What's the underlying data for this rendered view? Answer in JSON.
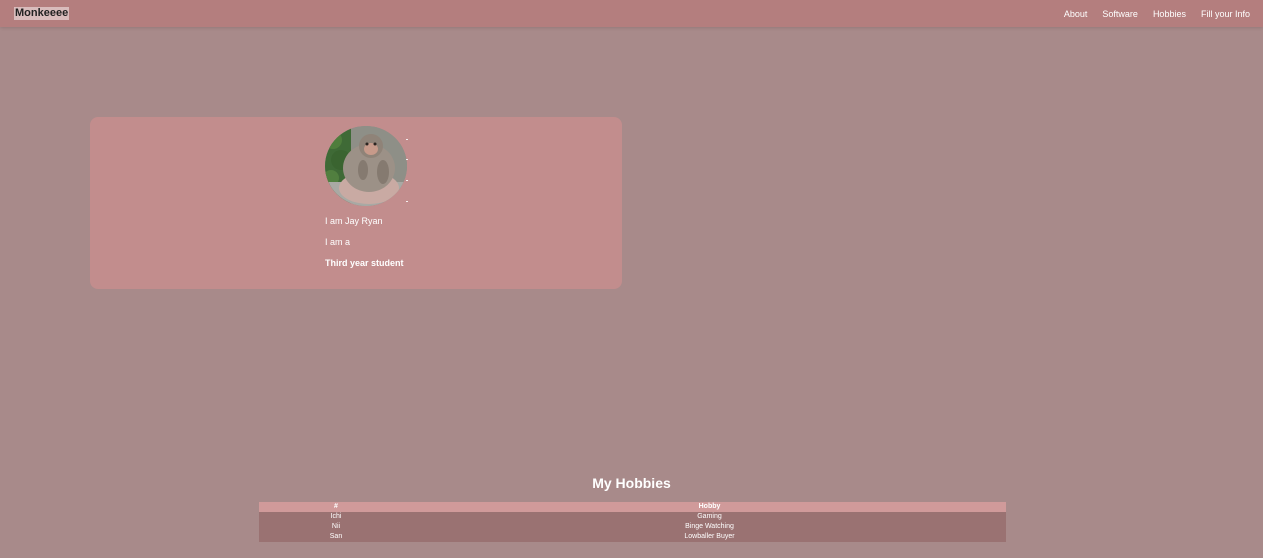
{
  "navbar": {
    "brand": "Monkeeee",
    "links": [
      {
        "label": "About"
      },
      {
        "label": "Software"
      },
      {
        "label": "Hobbies"
      },
      {
        "label": "Fill your Info"
      }
    ]
  },
  "profile": {
    "avatar_icon": "monkey-photo",
    "name_line": "I am Jay Ryan",
    "role_line": "I am a",
    "year_line": "Third year student"
  },
  "hobbies": {
    "title": "My Hobbies",
    "columns": [
      "#",
      "Hobby"
    ],
    "rows": [
      [
        "Ichi",
        "Gaming"
      ],
      [
        "Nii",
        "Binge Watching"
      ],
      [
        "San",
        "Lowballer Buyer"
      ]
    ]
  },
  "colors": {
    "page_background": "#a88a8a",
    "navbar": "#b47e7e",
    "card": "#c28d8d",
    "table_header": "#d09a9a",
    "table_body": "#9a7272"
  }
}
